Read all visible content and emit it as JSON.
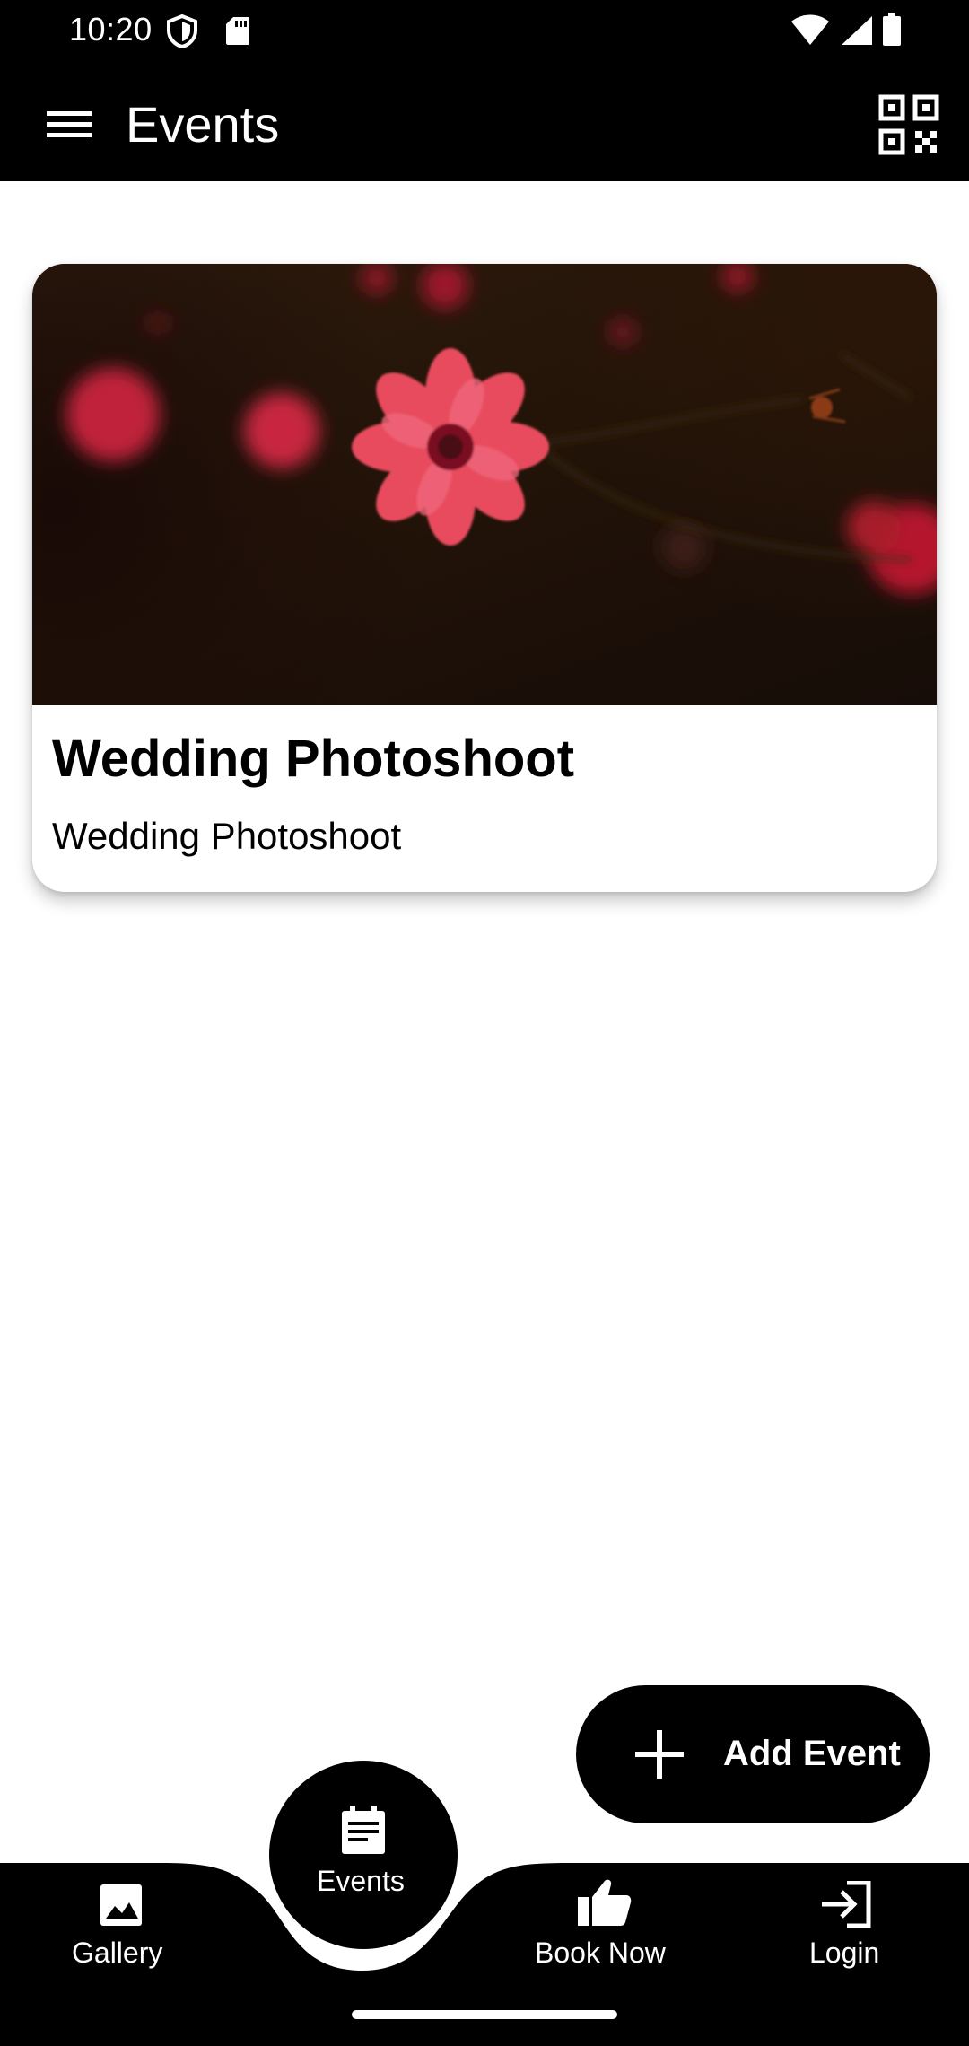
{
  "status_bar": {
    "time": "10:20",
    "icons": [
      "shield-icon",
      "sd-card-icon",
      "wifi-icon",
      "signal-icon",
      "battery-icon"
    ]
  },
  "app_bar": {
    "title": "Events",
    "menu_icon": "menu-icon",
    "action_icon": "qr-code-scan-icon"
  },
  "events": [
    {
      "title": "Wedding Photoshoot",
      "description": "Wedding Photoshoot",
      "image": "red-flower-photo"
    }
  ],
  "fab": {
    "label": "Add Event",
    "icon": "add-icon"
  },
  "bottom_nav": {
    "items": [
      {
        "label": "Gallery",
        "icon": "image-icon"
      },
      {
        "label": "Events",
        "icon": "event-note-icon",
        "selected": true
      },
      {
        "label": "Book Now",
        "icon": "thumb-up-icon"
      },
      {
        "label": "Login",
        "icon": "login-icon"
      }
    ]
  },
  "colors": {
    "bar": "#000000",
    "background": "#ffffff",
    "on_bar": "#ffffff"
  }
}
